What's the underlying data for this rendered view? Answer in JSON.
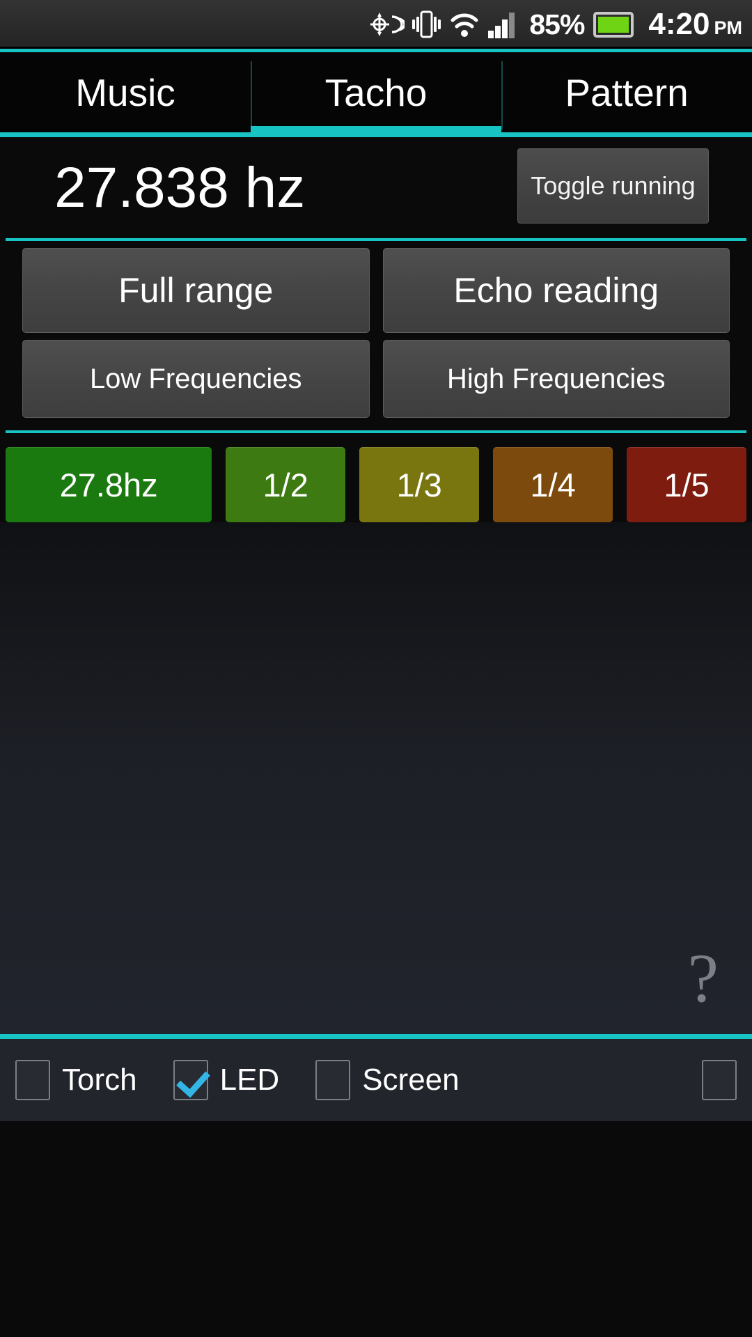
{
  "statusbar": {
    "icons": [
      "gps-icon",
      "vibrate-icon",
      "wifi-icon",
      "signal-icon"
    ],
    "battery_percent": "85%",
    "battery_icon": "battery-icon",
    "time": "4:20",
    "ampm": "PM"
  },
  "tabs": [
    {
      "label": "Music",
      "active": false
    },
    {
      "label": "Tacho",
      "active": true
    },
    {
      "label": "Pattern",
      "active": false
    }
  ],
  "readout": {
    "frequency": "27.838 hz",
    "toggle_label": "Toggle running"
  },
  "range_buttons": [
    {
      "label": "Full range"
    },
    {
      "label": "Echo reading"
    },
    {
      "label": "Low Frequencies"
    },
    {
      "label": "High Frequencies"
    }
  ],
  "chips": [
    {
      "label": "27.8hz",
      "color": "#1a7a0f"
    },
    {
      "label": "1/2",
      "color": "#3d7a12"
    },
    {
      "label": "1/3",
      "color": "#7a760f"
    },
    {
      "label": "1/4",
      "color": "#7d4a0d"
    },
    {
      "label": "1/5",
      "color": "#7e1c0f"
    }
  ],
  "help": {
    "glyph": "?"
  },
  "bottombar": {
    "items": [
      {
        "label": "Torch",
        "checked": false
      },
      {
        "label": "LED",
        "checked": true
      },
      {
        "label": "Screen",
        "checked": false
      },
      {
        "label": "",
        "checked": false
      }
    ]
  },
  "colors": {
    "accent_teal": "#18c3c3",
    "checkbox_check": "#33b5e5",
    "app_background": "#0a0a0a"
  }
}
